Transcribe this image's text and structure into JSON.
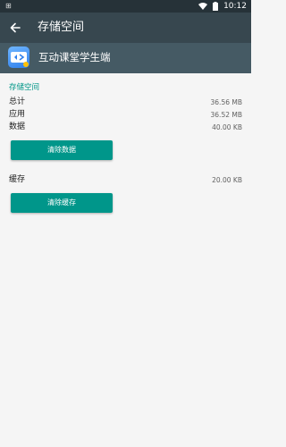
{
  "status_bar": {
    "left_text": "⊞",
    "time": "10:12"
  },
  "app_bar": {
    "title": "存储空间"
  },
  "app_header": {
    "app_name": "互动课堂学生端"
  },
  "storage": {
    "section_title": "存储空间",
    "rows": [
      {
        "label": "总计",
        "value": "36.56 MB"
      },
      {
        "label": "应用",
        "value": "36.52 MB"
      },
      {
        "label": "数据",
        "value": "40.00 KB"
      }
    ],
    "clear_data_label": "清除数据"
  },
  "cache": {
    "label": "缓存",
    "value": "20.00 KB",
    "clear_cache_label": "清除缓存"
  },
  "colors": {
    "status_bar_bg": "#263238",
    "app_bar_bg": "#37474f",
    "app_header_bg": "#455a64",
    "accent": "#009688",
    "background": "#f5f5f5"
  }
}
